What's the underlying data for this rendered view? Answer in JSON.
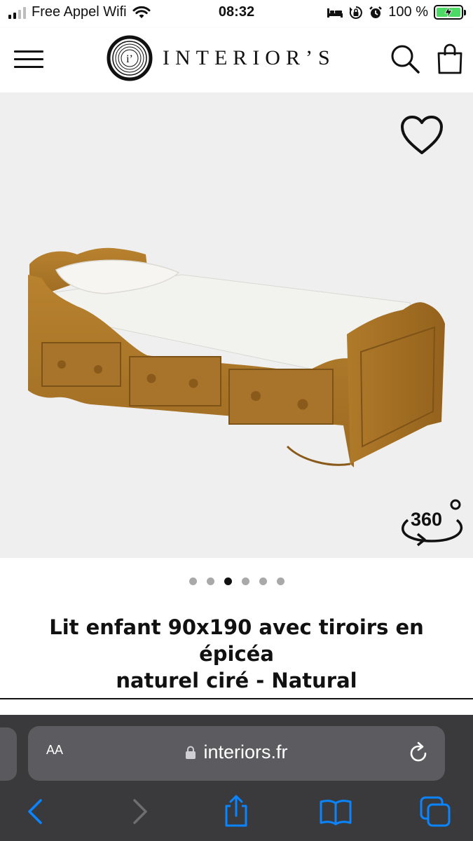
{
  "status_bar": {
    "carrier": "Free Appel Wifi",
    "time": "08:32",
    "battery_percent": "100 %",
    "signal_bars_active": 2,
    "icons": [
      "signal-icon",
      "wifi-icon",
      "bed-icon",
      "orientation-lock-icon",
      "alarm-icon",
      "battery-charging-icon"
    ]
  },
  "header": {
    "logo_text": "INTERIOR’S",
    "logo_mark": "i’",
    "icons": [
      "hamburger-menu-icon",
      "search-icon",
      "shopping-bag-icon"
    ]
  },
  "product": {
    "view360_label": "360",
    "carousel_total": 6,
    "carousel_active_index": 2,
    "title_line1": "Lit enfant 90x190 avec tiroirs en épicéa",
    "title_line2": "naturel ciré - Natural",
    "icons": [
      "heart-icon",
      "rotate-360-icon"
    ]
  },
  "browser": {
    "text_size_label": "AA",
    "url": "interiors.fr",
    "icons": [
      "lock-icon",
      "reload-icon",
      "back-icon",
      "forward-icon",
      "share-icon",
      "bookmarks-icon",
      "tabs-icon"
    ]
  },
  "colors": {
    "accent": "#111111",
    "image_background": "#efefef",
    "browser_bar": "#3a3a3c",
    "link_blue": "#0a84ff",
    "battery_green": "#4cd964"
  }
}
